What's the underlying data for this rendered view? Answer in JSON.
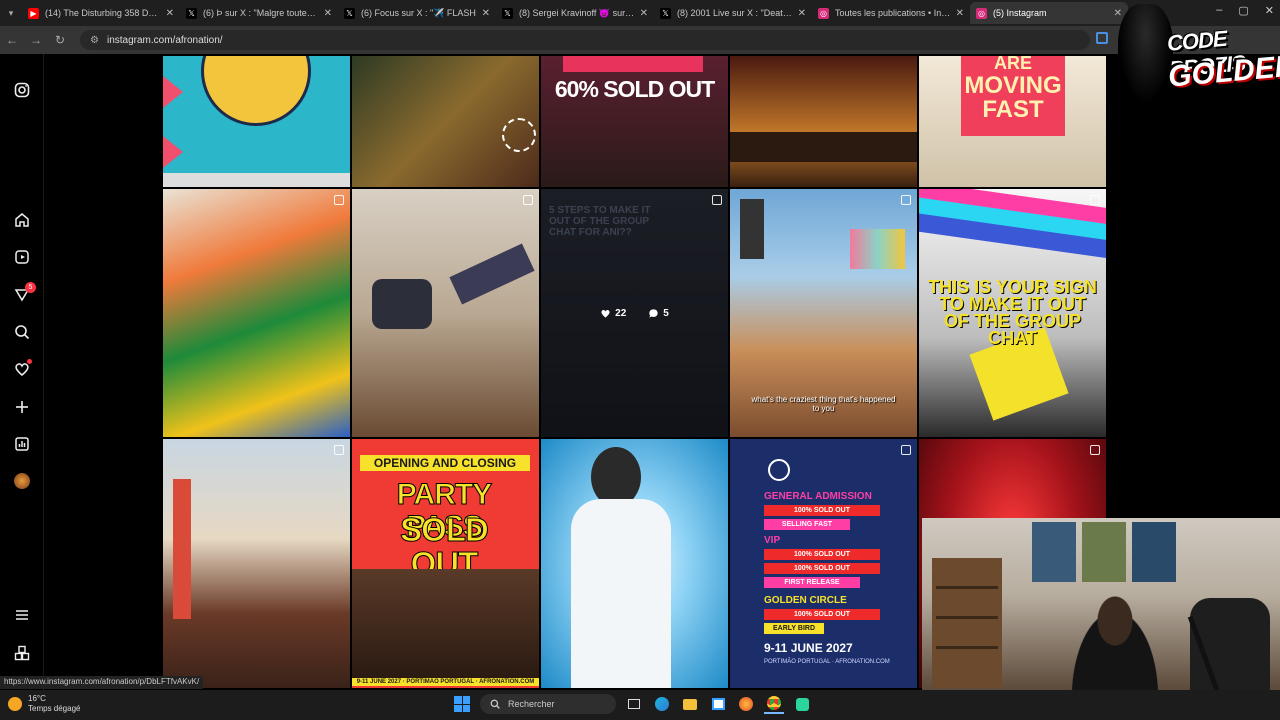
{
  "browser": {
    "tabs": [
      {
        "title": "(14) The Disturbing 358 Days D",
        "icon": "youtube-icon",
        "color": "#ff0000"
      },
      {
        "title": "(6) Ϸ sur X : \"Malgre toutes les",
        "icon": "x-icon",
        "color": "#000000"
      },
      {
        "title": "(6) Focus sur X : \"✈️ FLASH",
        "icon": "x-icon",
        "color": "#000000"
      },
      {
        "title": "(8) Sergei Kravinoff 😈 sur X :",
        "icon": "x-icon",
        "color": "#000000"
      },
      {
        "title": "(8) 2001 Live sur X : \"Death Ro",
        "icon": "x-icon",
        "color": "#000000"
      },
      {
        "title": "Toutes les publications • Instag",
        "icon": "instagram-icon",
        "color": "#d62976"
      },
      {
        "title": "(5) Instagram",
        "icon": "instagram-icon",
        "color": "#d62976",
        "active": true
      }
    ],
    "url": "instagram.com/afronation/",
    "status_url": "https://www.instagram.com/afronation/p/DbLFTfvAKvK/"
  },
  "instagram": {
    "rail": {
      "notifications_badge": "5"
    },
    "grid": {
      "hover_likes": "22",
      "hover_comments": "5",
      "tiles": {
        "sold60": "60% SOLD OUT",
        "moving_fast_top": "ARE",
        "moving_fast": "MOVING FAST",
        "steps": "5 STEPS TO MAKE IT OUT OF THE GROUP CHAT FOR ANI??",
        "sign": "THIS IS YOUR SIGN TO MAKE IT OUT OF THE GROUP CHAT",
        "caption_craziest": "what's the craziest thing that's happened to you",
        "party_pass_1": "OPENING AND CLOSING",
        "party_pass_2": "PARTY PASS",
        "party_pass_3": "SOLD OUT",
        "party_pass_footer": "9-11 JUNE 2027 · PORTIMÃO PORTUGAL · AFRONATION.COM",
        "ticket_general": "GENERAL ADMISSION",
        "ticket_vip": "VIP",
        "ticket_golden": "GOLDEN CIRCLE",
        "ticket_sold": "100% SOLD OUT",
        "ticket_early": "EARLY BIRD",
        "ticket_selling": "SELLING FAST",
        "ticket_first": "FIRST RELEASE",
        "ticket_date": "9-11 JUNE 2027",
        "ticket_footer": "PORTIMÃO PORTUGAL · AFRONATION.COM"
      }
    }
  },
  "overlay": {
    "logo_line1": "CODE PROZIS",
    "logo_line2": "GOLDENG"
  },
  "taskbar": {
    "temp": "16°C",
    "weather": "Temps dégagé",
    "search_label": "Rechercher"
  }
}
